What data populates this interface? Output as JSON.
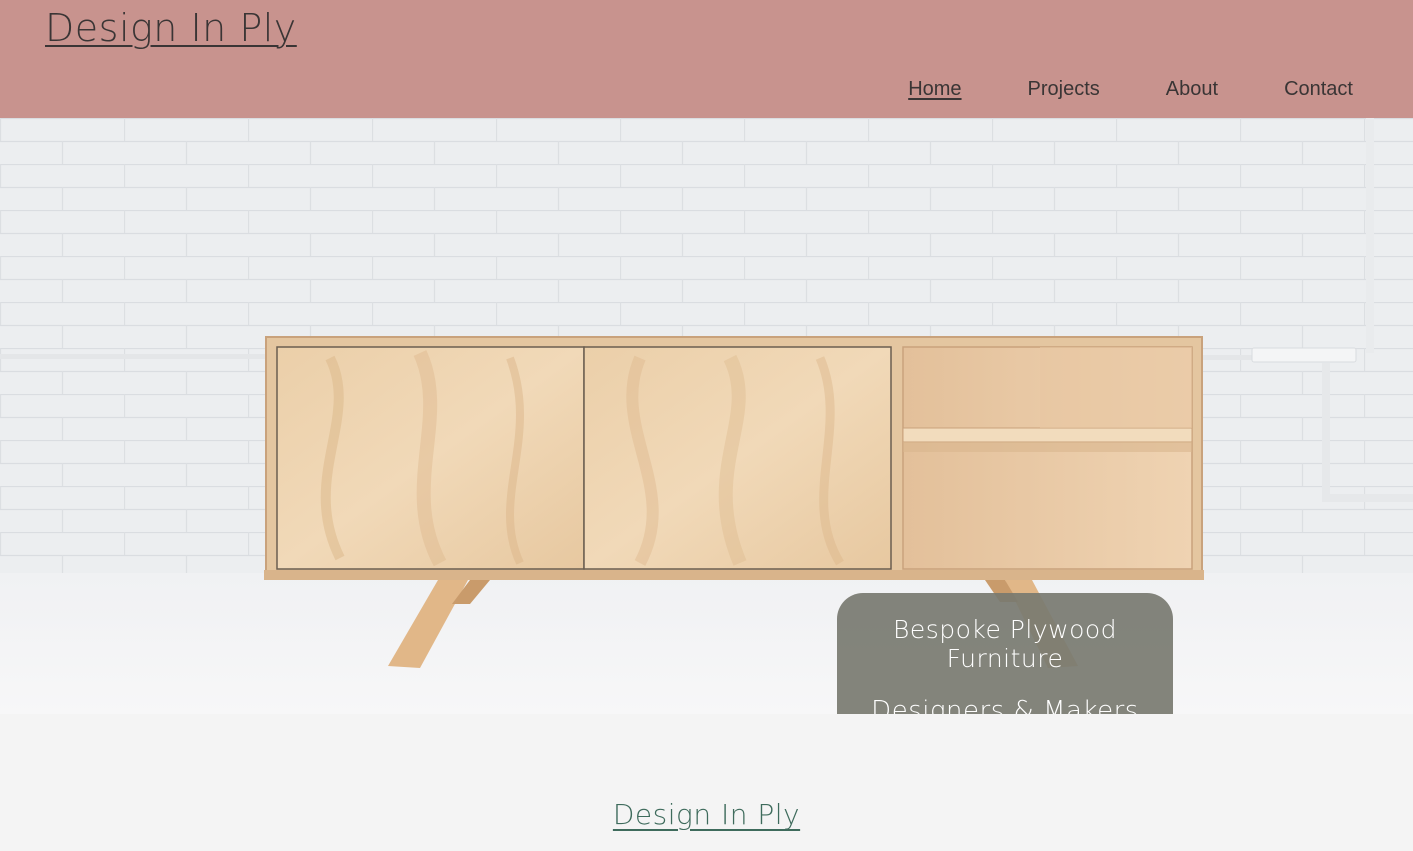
{
  "header": {
    "site_title": "Design In Ply",
    "nav": [
      {
        "label": "Home",
        "active": true
      },
      {
        "label": "Projects",
        "active": false
      },
      {
        "label": "About",
        "active": false
      },
      {
        "label": "Contact",
        "active": false
      }
    ]
  },
  "hero": {
    "image_subject": "plywood-sideboard-photo",
    "overlay": {
      "line1": "Bespoke Plywood Furniture",
      "line2": "Designers & Makers"
    }
  },
  "main": {
    "section_title": "Design In Ply"
  },
  "colors": {
    "header_bg": "#c8938e",
    "text_dark": "#3a3535",
    "accent_green": "#3e6b5c",
    "overlay_bg": "#787a70",
    "page_bg": "#f4f4f4"
  }
}
